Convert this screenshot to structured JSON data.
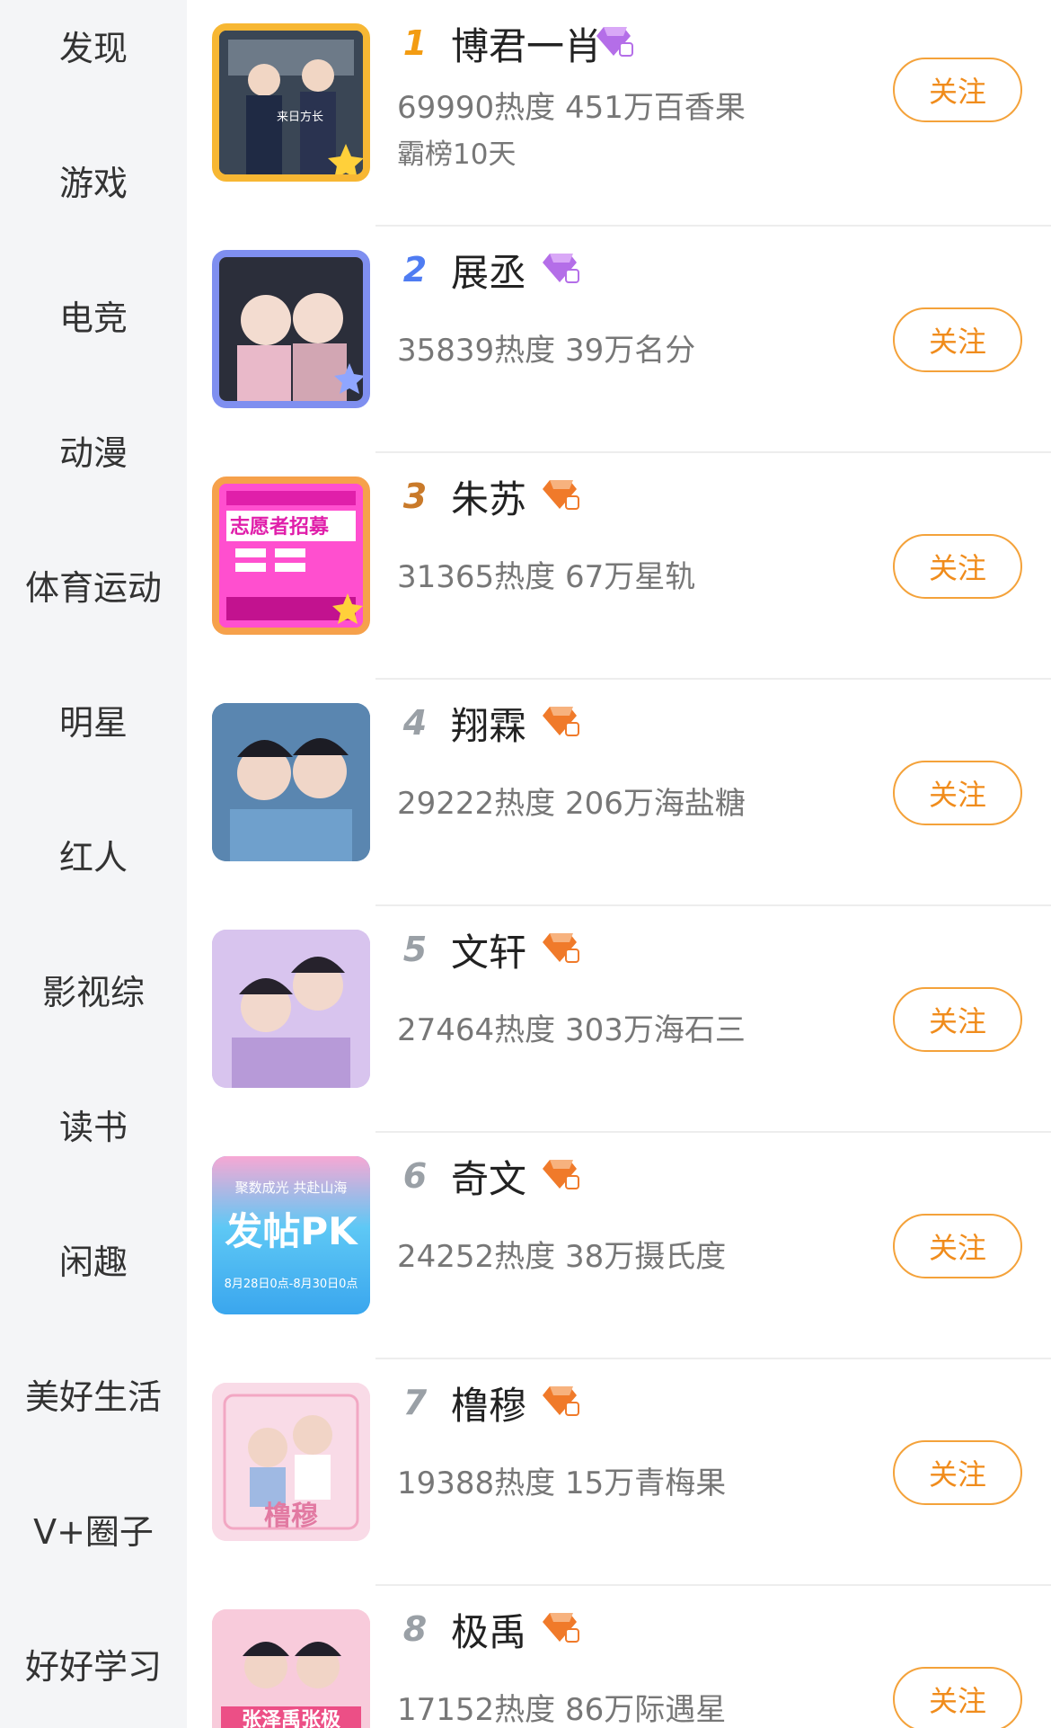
{
  "sidebar": {
    "items": [
      {
        "label": "发现"
      },
      {
        "label": "游戏"
      },
      {
        "label": "电竞"
      },
      {
        "label": "动漫"
      },
      {
        "label": "体育运动"
      },
      {
        "label": "明星"
      },
      {
        "label": "红人"
      },
      {
        "label": "影视综"
      },
      {
        "label": "读书"
      },
      {
        "label": "闲趣"
      },
      {
        "label": "美好生活"
      },
      {
        "label": "V+圈子"
      },
      {
        "label": "好好学习"
      }
    ]
  },
  "list": {
    "rows": [
      {
        "rank": "1",
        "name": "博君一肖",
        "stats": "69990热度 451万百香果",
        "extra": "霸榜10天",
        "follow": "关注",
        "thumb_text": "来日方长"
      },
      {
        "rank": "2",
        "name": "展丞",
        "stats": "35839热度 39万名分",
        "follow": "关注"
      },
      {
        "rank": "3",
        "name": "朱苏",
        "stats": "31365热度 67万星轨",
        "follow": "关注",
        "thumb_text": "志愿者招募"
      },
      {
        "rank": "4",
        "name": "翔霖",
        "stats": "29222热度 206万海盐糖",
        "follow": "关注"
      },
      {
        "rank": "5",
        "name": "文轩",
        "stats": "27464热度 303万海石三",
        "follow": "关注"
      },
      {
        "rank": "6",
        "name": "奇文",
        "stats": "24252热度 38万摄氏度",
        "follow": "关注",
        "thumb_text": "发帖PK",
        "thumb_top": "聚数成光 共赴山海",
        "thumb_bottom": "8月28日0点-8月30日0点"
      },
      {
        "rank": "7",
        "name": "橹穆",
        "stats": "19388热度 15万青梅果",
        "follow": "关注",
        "thumb_text": "橹穆"
      },
      {
        "rank": "8",
        "name": "极禹",
        "stats": "17152热度 86万际遇星",
        "follow": "关注",
        "thumb_text": "张泽禹张极"
      }
    ]
  },
  "colors": {
    "accent": "#f08c1c",
    "rank1": "#f39c12",
    "rank2": "#4f7cf2",
    "rank3": "#c97a2a",
    "gem_purple": "#b46ee8",
    "gem_orange": "#f07a2a"
  }
}
